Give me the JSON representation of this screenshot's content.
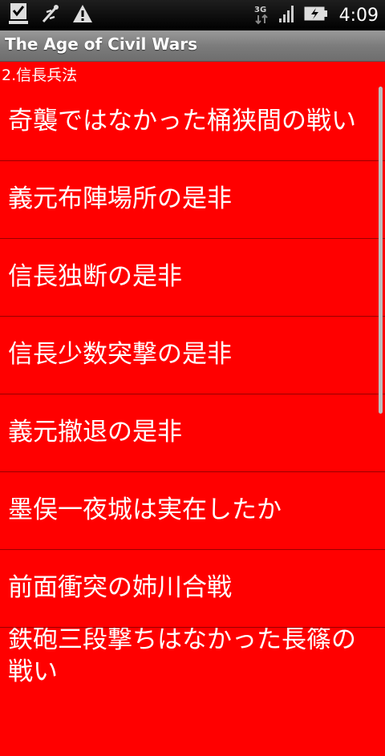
{
  "status_bar": {
    "time": "4:09",
    "network": "3G"
  },
  "title_bar": {
    "title": "The Age of Civil Wars"
  },
  "section": {
    "header": "2.信長兵法"
  },
  "list": {
    "items": [
      {
        "label": "奇襲ではなかった桶狭間の戦い"
      },
      {
        "label": "義元布陣場所の是非"
      },
      {
        "label": "信長独断の是非"
      },
      {
        "label": "信長少数突撃の是非"
      },
      {
        "label": "義元撤退の是非"
      },
      {
        "label": "墨俣一夜城は実在したか"
      },
      {
        "label": "前面衝突の姉川合戦"
      },
      {
        "label": "鉄砲三段撃ちはなかった長篠の戦い"
      }
    ]
  },
  "colors": {
    "background": "#ff0000",
    "divider": "#990000",
    "text": "#ffffff"
  }
}
